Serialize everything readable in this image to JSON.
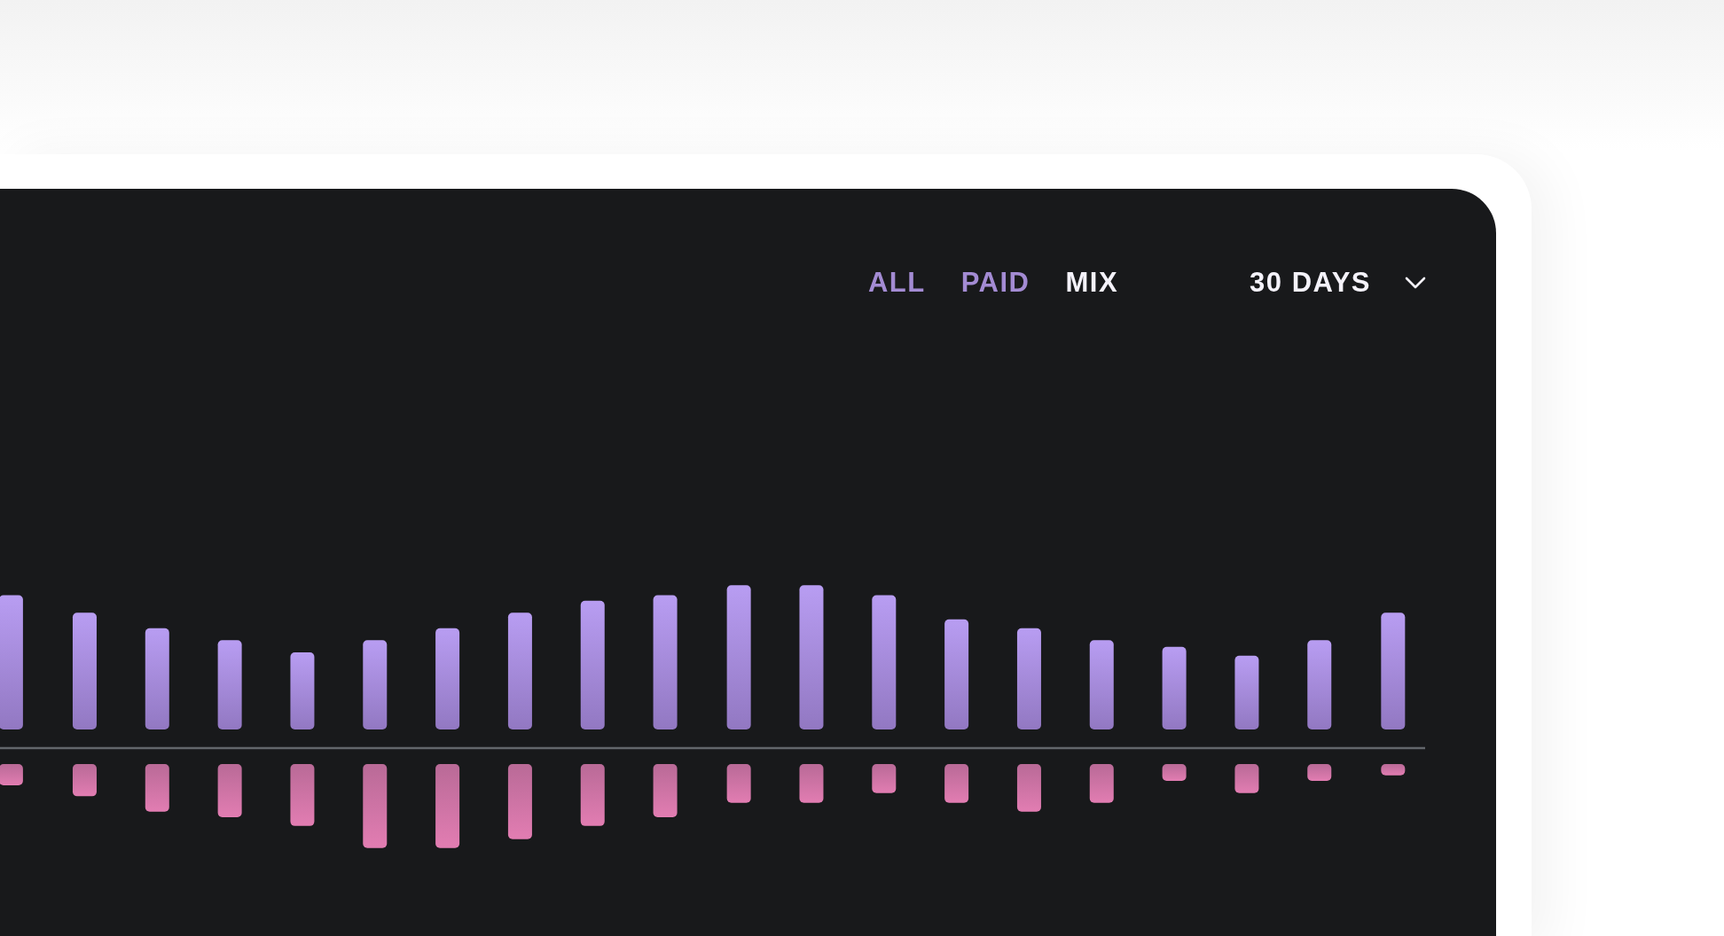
{
  "filters": [
    {
      "label": "ALL",
      "selected": false
    },
    {
      "label": "PAID",
      "selected": false
    },
    {
      "label": "MIX",
      "selected": true
    }
  ],
  "period": {
    "label": "30 DAYS"
  }
}
